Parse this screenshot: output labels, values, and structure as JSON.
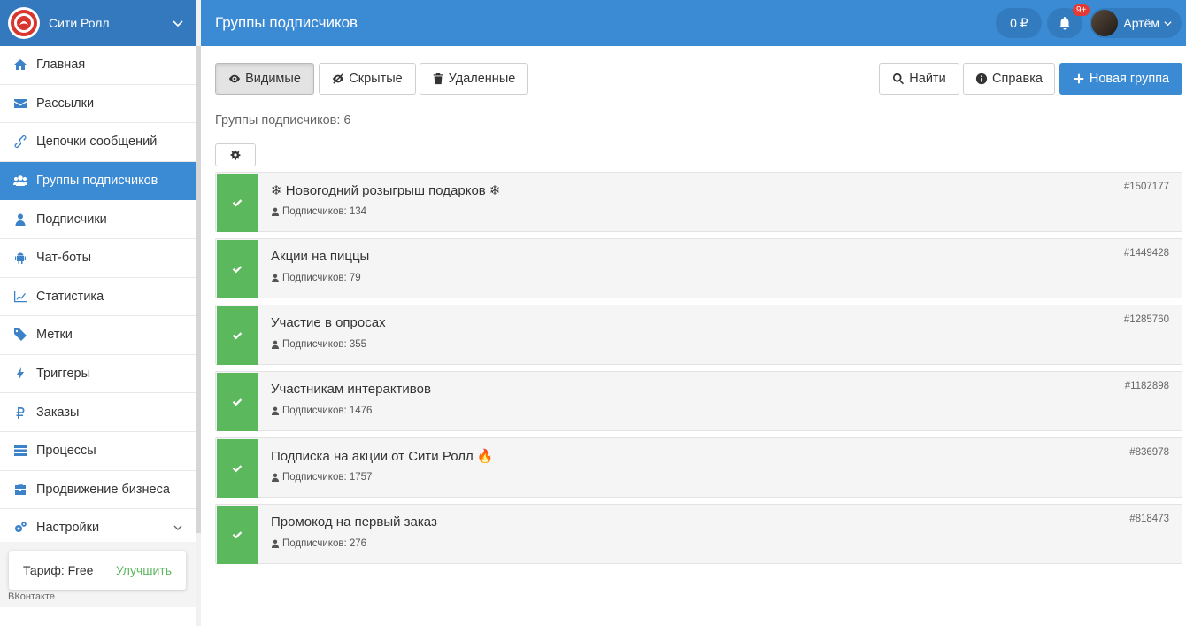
{
  "brand": {
    "name": "Сити Ролл",
    "logo_color": "#d9352f"
  },
  "sidebar": {
    "items": [
      {
        "label": "Главная",
        "icon": "home-icon"
      },
      {
        "label": "Рассылки",
        "icon": "envelope-icon"
      },
      {
        "label": "Цепочки сообщений",
        "icon": "link-icon"
      },
      {
        "label": "Группы подписчиков",
        "icon": "users-icon",
        "active": true
      },
      {
        "label": "Подписчики",
        "icon": "user-icon"
      },
      {
        "label": "Чат-боты",
        "icon": "android-icon"
      },
      {
        "label": "Статистика",
        "icon": "line-chart-icon"
      },
      {
        "label": "Метки",
        "icon": "tag-icon"
      },
      {
        "label": "Триггеры",
        "icon": "bolt-icon"
      },
      {
        "label": "Заказы",
        "icon": "ruble-icon"
      },
      {
        "label": "Процессы",
        "icon": "tasks-icon"
      },
      {
        "label": "Продвижение бизнеса",
        "icon": "briefcase-icon"
      },
      {
        "label": "Настройки",
        "icon": "cogs-icon",
        "has_submenu": true
      }
    ],
    "tariff_label": "Тариф: Free",
    "upgrade_label": "Улучшить",
    "platform": "ВКонтакте"
  },
  "topbar": {
    "title": "Группы подписчиков",
    "balance": "0 ₽",
    "notifications_badge": "9+",
    "user_name": "Артём"
  },
  "toolbar": {
    "visible_label": "Видимые",
    "hidden_label": "Скрытые",
    "deleted_label": "Удаленные",
    "find_label": "Найти",
    "help_label": "Справка",
    "new_group_label": "Новая группа"
  },
  "groups_count_label": "Группы подписчиков: 6",
  "groups": [
    {
      "name": "❄ Новогодний розыгрыш подарков ❄",
      "subscribers": "Подписчиков: 134",
      "id": "#1507177"
    },
    {
      "name": "Акции на пиццы",
      "subscribers": "Подписчиков: 79",
      "id": "#1449428"
    },
    {
      "name": "Участие в опросах",
      "subscribers": "Подписчиков: 355",
      "id": "#1285760"
    },
    {
      "name": "Участникам интерактивов",
      "subscribers": "Подписчиков: 1476",
      "id": "#1182898"
    },
    {
      "name": "Подписка на акции от Сити Ролл 🔥",
      "subscribers": "Подписчиков: 1757",
      "id": "#836978"
    },
    {
      "name": "Промокод на первый заказ",
      "subscribers": "Подписчиков: 276",
      "id": "#818473"
    }
  ],
  "colors": {
    "primary": "#3b8ad4",
    "success": "#5cb85c",
    "brand_dark": "#3478bd"
  }
}
